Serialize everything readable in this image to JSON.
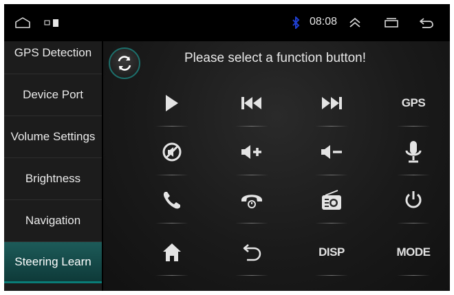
{
  "statusbar": {
    "time": "08:08",
    "icons": [
      "home-outline-icon",
      "notification-icons",
      "bluetooth-icon",
      "expand-up-icon",
      "recent-apps-icon",
      "back-icon"
    ]
  },
  "sidebar": {
    "items": [
      {
        "label": "GPS Detection",
        "active": false
      },
      {
        "label": "Device Port",
        "active": false
      },
      {
        "label": "Volume Settings",
        "active": false
      },
      {
        "label": "Brightness",
        "active": false
      },
      {
        "label": "Navigation",
        "active": false
      },
      {
        "label": "Steering Learn",
        "active": true
      }
    ]
  },
  "main": {
    "prompt": "Please select a function button!",
    "refresh_icon": "refresh-icon",
    "buttons": {
      "play": {
        "icon": "play-icon"
      },
      "prev": {
        "icon": "previous-track-icon"
      },
      "next": {
        "icon": "next-track-icon"
      },
      "gps": {
        "label": "GPS"
      },
      "mute": {
        "icon": "mute-icon"
      },
      "vol_up": {
        "icon": "volume-up-icon"
      },
      "vol_down": {
        "icon": "volume-down-icon"
      },
      "mic": {
        "icon": "microphone-icon"
      },
      "call": {
        "icon": "phone-call-icon"
      },
      "hangup": {
        "icon": "hang-up-icon"
      },
      "radio": {
        "icon": "radio-icon"
      },
      "power": {
        "icon": "power-icon"
      },
      "home": {
        "icon": "home-icon"
      },
      "back": {
        "icon": "back-return-icon"
      },
      "disp": {
        "label": "DISP"
      },
      "mode": {
        "label": "MODE"
      }
    }
  },
  "colors": {
    "accent": "#1d5b59",
    "accent_line": "#0a7d78",
    "bluetooth": "#1f3fd1",
    "background": "#0a0a0a"
  }
}
